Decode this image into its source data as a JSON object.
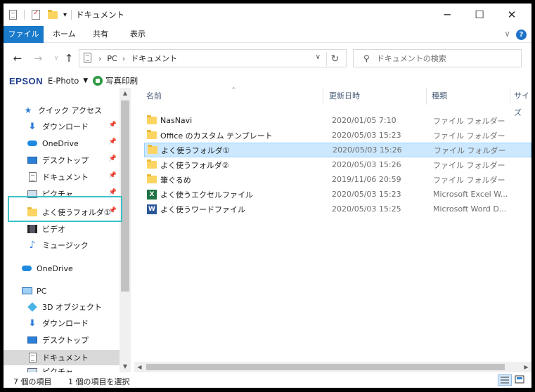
{
  "window": {
    "title": "ドキュメント"
  },
  "quick_access_toolbar": {
    "dropdown_glyph": "▾"
  },
  "window_controls": {
    "minimize": "─",
    "maximize": "☐",
    "close": "✕"
  },
  "ribbon": {
    "tabs": [
      {
        "label": "ファイル"
      },
      {
        "label": "ホーム"
      },
      {
        "label": "共有"
      },
      {
        "label": "表示"
      }
    ],
    "help": "?",
    "expand_glyph": "∨"
  },
  "address_bar": {
    "back": "←",
    "forward": "→",
    "up": "↑",
    "crumbs": [
      "PC",
      "ドキュメント"
    ],
    "separator": "›",
    "refresh": "↻"
  },
  "search": {
    "placeholder": "ドキュメントの検索",
    "icon": "⚲"
  },
  "epson_bar": {
    "logo": "EPSON",
    "app": "E-Photo",
    "dropdown": "▼",
    "print": "写真印刷"
  },
  "nav_pane": {
    "items": [
      {
        "label": "クイック アクセス",
        "icon": "star-icon",
        "pinned": false
      },
      {
        "label": "ダウンロード",
        "icon": "download-icon",
        "pinned": true
      },
      {
        "label": "OneDrive",
        "icon": "onedrive-icon",
        "pinned": true
      },
      {
        "label": "デスクトップ",
        "icon": "desktop-icon",
        "pinned": true
      },
      {
        "label": "ドキュメント",
        "icon": "document-icon",
        "pinned": true
      },
      {
        "label": "ピクチャ",
        "icon": "pictures-icon",
        "pinned": true
      },
      {
        "label": "よく使うフォルダ①",
        "icon": "folder-icon",
        "pinned": true
      },
      {
        "label": "ビデオ",
        "icon": "video-icon",
        "pinned": false
      },
      {
        "label": "ミュージック",
        "icon": "music-icon",
        "pinned": false
      },
      {
        "label": "OneDrive",
        "icon": "onedrive-icon",
        "pinned": false
      },
      {
        "label": "PC",
        "icon": "pc-icon",
        "pinned": false
      },
      {
        "label": "3D オブジェクト",
        "icon": "3d-objects-icon",
        "pinned": false
      },
      {
        "label": "ダウンロード",
        "icon": "download-icon",
        "pinned": false
      },
      {
        "label": "デスクトップ",
        "icon": "desktop-icon",
        "pinned": false
      },
      {
        "label": "ドキュメント",
        "icon": "document-icon",
        "pinned": false,
        "selected": true
      },
      {
        "label": "ピクチャ",
        "icon": "pictures-icon",
        "pinned": false
      }
    ],
    "pin_glyph": "📌",
    "scroll_up": "▲",
    "scroll_down": "▼"
  },
  "file_list": {
    "columns": {
      "name": "名前",
      "modified": "更新日時",
      "type": "種類",
      "size": "サイズ"
    },
    "sort_glyph": "^",
    "rows": [
      {
        "name": "NasNavi",
        "modified": "2020/01/05 7:10",
        "type": "ファイル フォルダー",
        "icon": "folder-icon"
      },
      {
        "name": "Office のカスタム テンプレート",
        "modified": "2020/05/03 15:23",
        "type": "ファイル フォルダー",
        "icon": "folder-icon"
      },
      {
        "name": "よく使うフォルダ①",
        "modified": "2020/05/03 15:26",
        "type": "ファイル フォルダー",
        "icon": "folder-icon",
        "selected": true
      },
      {
        "name": "よく使うフォルダ②",
        "modified": "2020/05/03 15:26",
        "type": "ファイル フォルダー",
        "icon": "folder-icon"
      },
      {
        "name": "筆ぐるめ",
        "modified": "2019/11/06 20:59",
        "type": "ファイル フォルダー",
        "icon": "folder-icon"
      },
      {
        "name": "よく使うエクセルファイル",
        "modified": "2020/05/03 15:23",
        "type": "Microsoft Excel W...",
        "icon": "excel-icon"
      },
      {
        "name": "よく使うワードファイル",
        "modified": "2020/05/03 15:25",
        "type": "Microsoft Word D...",
        "icon": "word-icon"
      }
    ],
    "scroll_left": "◀",
    "scroll_right": "▶"
  },
  "status_bar": {
    "count": "7 個の項目",
    "selected": "1 個の項目を選択"
  },
  "file_icon_letters": {
    "excel": "X",
    "word": "W"
  },
  "colors": {
    "accent": "#1979ca",
    "selection": "#cce8ff",
    "highlight_box": "#3cc1c9"
  }
}
